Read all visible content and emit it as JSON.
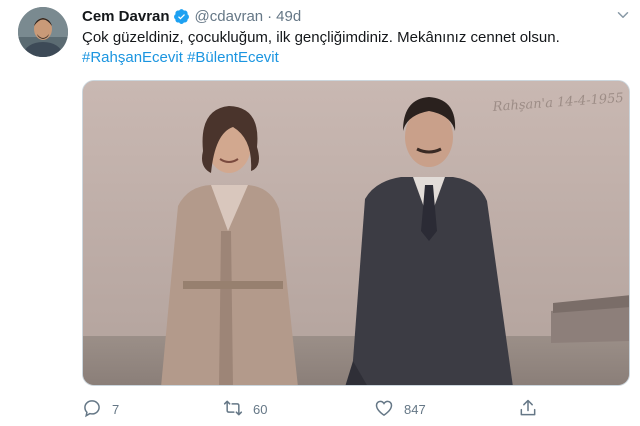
{
  "tweet": {
    "author": {
      "display_name": "Cem Davran",
      "handle": "@cdavran",
      "verified": true
    },
    "separator": "·",
    "time": "49d",
    "text": "Çok güzeldiniz, çocukluğum, ilk gençliğimdiniz. Mekânınız cennet olsun.",
    "hashtags": [
      "#RahşanEcevit",
      "#BülentEcevit"
    ],
    "photo": {
      "handwritten_inscription": "Rahşan'a 14-4-1955"
    }
  },
  "actions": {
    "reply": {
      "icon": "reply-icon",
      "count": "7"
    },
    "retweet": {
      "icon": "retweet-icon",
      "count": "60"
    },
    "like": {
      "icon": "heart-icon",
      "count": "847"
    },
    "share": {
      "icon": "share-icon"
    }
  },
  "colors": {
    "text": "#14171a",
    "secondary": "#657786",
    "link": "#1b95e0",
    "verified": "#1da1f2"
  }
}
